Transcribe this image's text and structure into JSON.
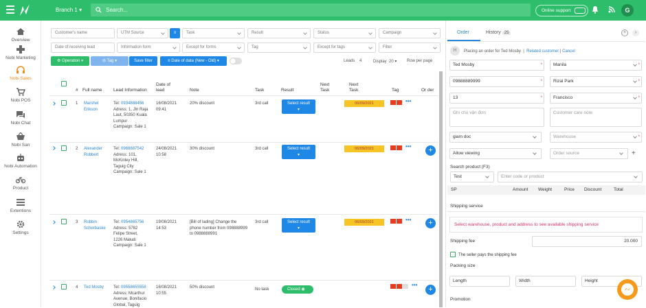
{
  "topbar": {
    "branch": "Branch 1",
    "search_placeholder": "Search...",
    "online_support": "Online support",
    "avatar": "G"
  },
  "sidebar": [
    {
      "label": "Overview",
      "icon": "home-icon"
    },
    {
      "label": "Nobi Marketing",
      "icon": "gamepad-icon"
    },
    {
      "label": "Nobi Sales",
      "icon": "headset-icon"
    },
    {
      "label": "Nobi POS",
      "icon": "cart-icon"
    },
    {
      "label": "Nobi Chat",
      "icon": "chat-icon"
    },
    {
      "label": "Nobi San",
      "icon": "basket-icon"
    },
    {
      "label": "Nobi Automation",
      "icon": "robot-icon"
    },
    {
      "label": "Product",
      "icon": "bike-icon"
    },
    {
      "label": "Extentions",
      "icon": "list-icon"
    },
    {
      "label": "Settings",
      "icon": "gear-icon"
    }
  ],
  "filters": {
    "customer_name": "Customer's name",
    "utm_source": "UTM Source",
    "task": "Task",
    "result": "Result",
    "status": "Status",
    "campaign": "Campaign",
    "receiving_lead": "Date of receiving lead",
    "information_form": "Information form",
    "except_forms": "Except for forms",
    "tag": "Tag",
    "except_tags": "Except for tags",
    "filter": "Filter"
  },
  "toolbar": {
    "operation": "Operation",
    "tag": "Tag",
    "save_filter": "Save filter",
    "date_sort": "Date of data (New - Old)",
    "leads_label": "Leads",
    "leads_count": "4",
    "display_label": "Display",
    "display_value": "20",
    "per_page": "Row per page"
  },
  "columns": {
    "num": "#",
    "full_name": "Full name",
    "lead_info": "Lead Information",
    "date": "Date of lead",
    "note": "Note",
    "task": "Task",
    "result": "Result",
    "next_task": "Next Task",
    "next_task2": "Next Task",
    "tag": "Tag",
    "order": "Or der"
  },
  "rows": [
    {
      "num": "1",
      "name": "Marshel Erikson",
      "tel": "0934888456",
      "info": [
        "Adress: 1, Jln Raja",
        "Laut, 50350 Kuala",
        "Lumpur",
        "Campaign: Sale 1"
      ],
      "date": "16/08/2021",
      "time": "09:41",
      "note": "20% discount",
      "task": "3rd call",
      "result": "Select result",
      "next": "06/09/2021"
    },
    {
      "num": "2",
      "name": "Alexander Robbert",
      "tel": "0968887542",
      "info": [
        "Adress: 101,",
        "McKinley Hill,",
        "Taguig City",
        "Campaign: Sale 1"
      ],
      "date": "24/08/2021",
      "time": "10:58",
      "note": "30% discount",
      "task": "3rd call",
      "result": "Select result",
      "next": "06/09/2021"
    },
    {
      "num": "3",
      "name": "Robbin Scherbaske",
      "tel": "0954865756",
      "info": [
        "Adress: 5782",
        "Felipe Street,",
        "1226 Makati",
        "Campaign: Sale 1"
      ],
      "date": "19/08/2021",
      "time": "14:53",
      "note": "[Bill of lading] Change the phone number from 098888999 to 0988888991",
      "task": "3rd call",
      "result": "Select result",
      "next": "06/09/2021"
    },
    {
      "num": "4",
      "name": "Ted Mosby",
      "tel": "09558655558",
      "info": [
        "Adress: Mcarthur",
        "Avenue, Bonifacio",
        "Global, Taguig"
      ],
      "date": "16/08/2021",
      "time": "10:55",
      "note": "50% discount",
      "task": "No task",
      "result": "Closed",
      "next": ""
    }
  ],
  "order": {
    "tabs": {
      "order": "Order",
      "history": "History",
      "history_count": "25"
    },
    "placing_prefix": "Placing an order for Ted Mosby",
    "related": "Related customer",
    "cancel": "Cancel",
    "fields": {
      "name": "Ted Mosby",
      "city": "Manila",
      "phone": "09888889999",
      "district": "Rizal Park",
      "num": "13",
      "ward": "Francisco",
      "delivery_note_ph": "Ghi chú vận đơn",
      "care_note_ph": "Customer care note",
      "position": "giam doc",
      "warehouse_ph": "Warehouse",
      "allow": "Allow viewing",
      "order_source_ph": "Order source"
    },
    "search_product_label": "Search product (F3)",
    "search_select": "Test",
    "search_ph": "Enter code or product",
    "product_cols": [
      "SP",
      "Amount",
      "Weight",
      "Price",
      "Discount",
      "Total"
    ],
    "shipping_service": "Shipping service",
    "shipping_msg": "Select warehouse, product and address to see available shipping service",
    "shipping_fee_label": "Shipping fee",
    "shipping_fee": "20.000",
    "seller_pays": "The seller pays the shipping fee",
    "packing_size": "Packing size",
    "length": "Length",
    "width": "Width",
    "height": "Height",
    "promotion": "Promotion"
  },
  "colors": {
    "green": "#2ebd6b",
    "blue": "#1f87e5",
    "orange": "#ef8c1e",
    "yellow": "#f6c425"
  }
}
